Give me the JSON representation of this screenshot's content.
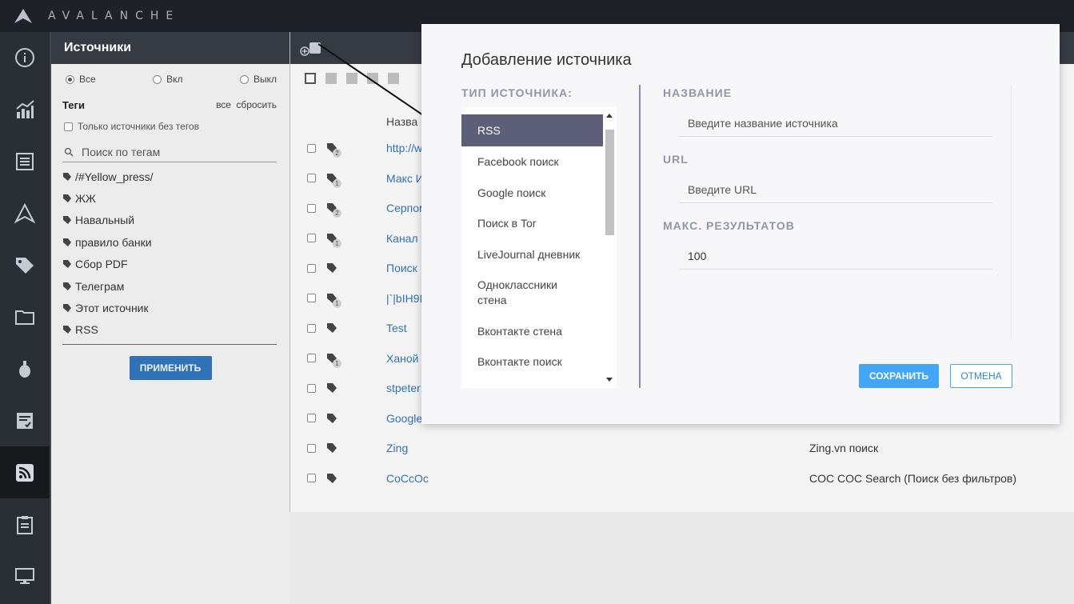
{
  "app": {
    "brand": "AVALANCHE"
  },
  "rail": {
    "items": [
      {
        "icon": "info-icon"
      },
      {
        "icon": "analytics-icon"
      },
      {
        "icon": "news-icon"
      },
      {
        "icon": "avalanche-icon"
      },
      {
        "icon": "tag-icon"
      },
      {
        "icon": "folder-icon"
      },
      {
        "icon": "grenade-icon"
      },
      {
        "icon": "task-icon"
      },
      {
        "icon": "rss-icon",
        "active": true
      },
      {
        "icon": "clipboard-icon"
      },
      {
        "icon": "monitor-icon"
      }
    ]
  },
  "sources_panel": {
    "title": "Источники",
    "filters": {
      "all": "Все",
      "on": "Вкл",
      "off": "Выкл",
      "selected": "all"
    },
    "tags_title": "Теги",
    "tags_all": "все",
    "tags_reset": "сбросить",
    "only_untagged": "Только источники без тегов",
    "tag_search_placeholder": "Поиск по тегам",
    "tags": [
      "/#Yellow_press/",
      "ЖЖ",
      "Навальный",
      "правило банки",
      "Сбор PDF",
      "Телеграм",
      "Этот источник",
      "RSS"
    ],
    "apply_label": "ПРИМЕНИТЬ"
  },
  "table": {
    "header_name": "Назва",
    "rows": [
      {
        "name": "http://w",
        "count": "2",
        "type": ""
      },
      {
        "name": "Макс И",
        "count": "1",
        "type": ""
      },
      {
        "name": "Серпом",
        "count": "2",
        "type": ""
      },
      {
        "name": "Канал",
        "count": "1",
        "type": ""
      },
      {
        "name": "Поиск",
        "count": "",
        "type": ""
      },
      {
        "name": "|`|bIH9I",
        "count": "1",
        "type": ""
      },
      {
        "name": "Test",
        "count": "",
        "type": ""
      },
      {
        "name": "Ханой",
        "count": "1",
        "type": ""
      },
      {
        "name": "stpeter",
        "count": "",
        "type": ""
      },
      {
        "name": "Google",
        "count": "",
        "type": ""
      },
      {
        "name": "Zing",
        "count": "",
        "type": "Zing.vn поиск"
      },
      {
        "name": "CoCcOc",
        "count": "",
        "type": "COC COC Search (Поиск без фильтров)"
      }
    ]
  },
  "modal": {
    "title": "Добавление источника",
    "type_label": "ТИП ИСТОЧНИКА:",
    "types": [
      "RSS",
      "Facebook поиск",
      "Google поиск",
      "Поиск в Tor",
      "LiveJournal дневник",
      "Одноклассники стена",
      "Вконтакте стена",
      "Вконтакте поиск"
    ],
    "selected_type": "RSS",
    "name_label": "НАЗВАНИЕ",
    "name_placeholder": "Введите название источника",
    "url_label": "URL",
    "url_placeholder": "Введите URL",
    "max_label": "МАКС. РЕЗУЛЬТАТОВ",
    "max_value": "100",
    "save_label": "СОХРАНИТЬ",
    "cancel_label": "ОТМЕНА"
  }
}
